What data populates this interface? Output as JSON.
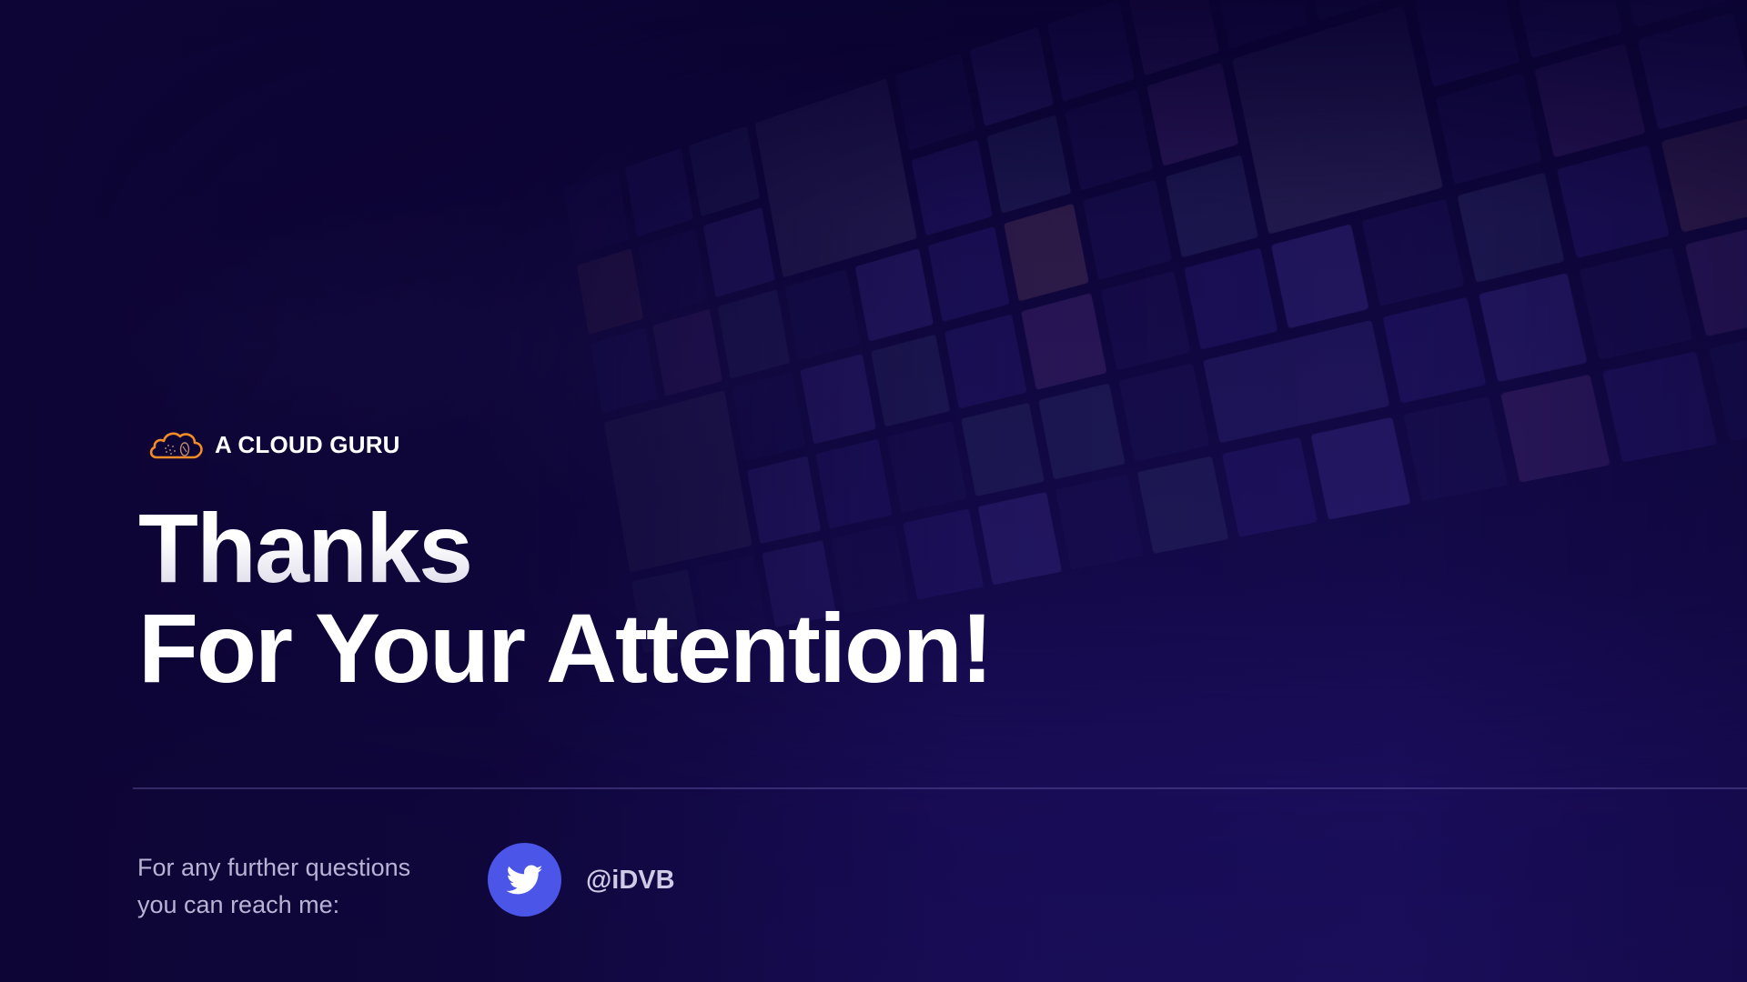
{
  "brand": {
    "name": "A CLOUD GURU",
    "icon": "cloud-guru-logo-icon",
    "accent_color": "#F28C28"
  },
  "headline": {
    "line1": "Thanks",
    "line2": "For Your Attention!"
  },
  "contact": {
    "line1": "For any further questions",
    "line2": "you can reach me:",
    "twitter_icon": "twitter-icon",
    "twitter_button_color": "#4B56E8",
    "handle": "@iDVB"
  },
  "theme": {
    "background": "#0D0535",
    "text": "#FFFFFF",
    "muted_text": "#B9B3D6"
  }
}
